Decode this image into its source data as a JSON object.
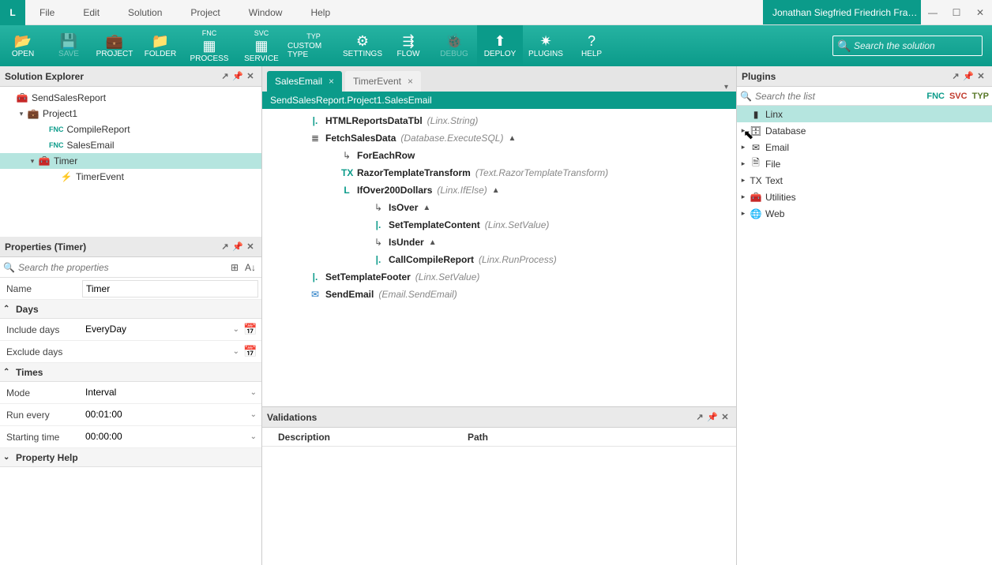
{
  "window": {
    "user": "Jonathan Siegfried Friedrich Fra…",
    "logo": "L"
  },
  "menu": {
    "items": [
      "File",
      "Edit",
      "Solution",
      "Project",
      "Window",
      "Help"
    ]
  },
  "toolbar": {
    "open": "OPEN",
    "save": "SAVE",
    "project": "PROJECT",
    "folder": "FOLDER",
    "process": "PROCESS",
    "process_top": "FNC",
    "service": "SERVICE",
    "service_top": "SVC",
    "customtype": "CUSTOM TYPE",
    "customtype_top": "TYP",
    "settings": "SETTINGS",
    "flow": "FLOW",
    "debug": "DEBUG",
    "deploy": "DEPLOY",
    "plugins": "PLUGINS",
    "help": "HELP",
    "search_placeholder": "Search the solution"
  },
  "solutionExplorer": {
    "title": "Solution Explorer",
    "items": [
      {
        "label": "SendSalesReport",
        "icon": "🧰",
        "indent": 0,
        "exp": ""
      },
      {
        "label": "Project1",
        "icon": "💼",
        "indent": 1,
        "exp": "▾"
      },
      {
        "label": "CompileReport",
        "fnc": "FNC",
        "indent": 3,
        "exp": ""
      },
      {
        "label": "SalesEmail",
        "fnc": "FNC",
        "indent": 3,
        "exp": ""
      },
      {
        "label": "Timer",
        "icon": "🧰",
        "indent": 2,
        "exp": "▾",
        "selected": true
      },
      {
        "label": "TimerEvent",
        "icon": "⚡",
        "indent": 4,
        "exp": ""
      }
    ]
  },
  "properties": {
    "title": "Properties (Timer)",
    "search_placeholder": "Search the properties",
    "rows": {
      "name_label": "Name",
      "name_value": "Timer",
      "section_days": "Days",
      "include_label": "Include days",
      "include_value": "EveryDay",
      "exclude_label": "Exclude days",
      "exclude_value": "",
      "section_times": "Times",
      "mode_label": "Mode",
      "mode_value": "Interval",
      "runevery_label": "Run every",
      "runevery_value": "00:01:00",
      "start_label": "Starting time",
      "start_value": "00:00:00",
      "section_help": "Property Help"
    }
  },
  "editor": {
    "tabs": [
      {
        "label": "SalesEmail",
        "active": true
      },
      {
        "label": "TimerEvent",
        "active": false
      }
    ],
    "path": "SendSalesReport.Project1.SalesEmail",
    "flow": [
      {
        "indent": 1,
        "iconClass": "iconL",
        "icon": "|.",
        "name": "HTMLReportsDataTbl",
        "hint": "(Linx.String)"
      },
      {
        "indent": 1,
        "iconClass": "iconDB",
        "icon": "≣",
        "name": "FetchSalesData",
        "hint": "(Database.ExecuteSQL)",
        "tri": "▲"
      },
      {
        "indent": 2,
        "iconClass": "iconArr",
        "icon": "↳",
        "name": "ForEachRow",
        "hint": ""
      },
      {
        "indent": 2,
        "iconClass": "iconTX",
        "icon": "TX",
        "name": "RazorTemplateTransform",
        "hint": "(Text.RazorTemplateTransform)"
      },
      {
        "indent": 2,
        "iconClass": "iconL",
        "icon": "L",
        "name": "IfOver200Dollars",
        "hint": "(Linx.IfElse)",
        "tri": "▲"
      },
      {
        "indent": 3,
        "iconClass": "iconArr",
        "icon": "↳",
        "name": "IsOver",
        "hint": "",
        "tri": "▲"
      },
      {
        "indent": 3,
        "iconClass": "iconL",
        "icon": "|.",
        "name": "SetTemplateContent",
        "hint": "(Linx.SetValue)"
      },
      {
        "indent": 3,
        "iconClass": "iconArr",
        "icon": "↳",
        "name": "IsUnder",
        "hint": "",
        "tri": "▲"
      },
      {
        "indent": 3,
        "iconClass": "iconL",
        "icon": "|.",
        "name": "CallCompileReport",
        "hint": "(Linx.RunProcess)"
      },
      {
        "indent": 1,
        "iconClass": "iconL",
        "icon": "|.",
        "name": "SetTemplateFooter",
        "hint": "(Linx.SetValue)"
      },
      {
        "indent": 1,
        "iconClass": "iconMail",
        "icon": "✉",
        "name": "SendEmail",
        "hint": "(Email.SendEmail)"
      }
    ]
  },
  "validations": {
    "title": "Validations",
    "col1": "Description",
    "col2": "Path"
  },
  "plugins": {
    "title": "Plugins",
    "search_placeholder": "Search the list",
    "filters": [
      "FNC",
      "SVC",
      "TYP"
    ],
    "items": [
      {
        "label": "Linx",
        "icon": "▮",
        "selected": true,
        "exp": ""
      },
      {
        "label": "Database",
        "icon": "🗄",
        "exp": "▸"
      },
      {
        "label": "Email",
        "icon": "✉",
        "exp": "▸"
      },
      {
        "label": "File",
        "icon": "🗎",
        "exp": "▸"
      },
      {
        "label": "Text",
        "icon": "TX",
        "exp": "▸"
      },
      {
        "label": "Utilities",
        "icon": "🧰",
        "exp": "▸"
      },
      {
        "label": "Web",
        "icon": "🌐",
        "exp": "▸"
      }
    ]
  }
}
